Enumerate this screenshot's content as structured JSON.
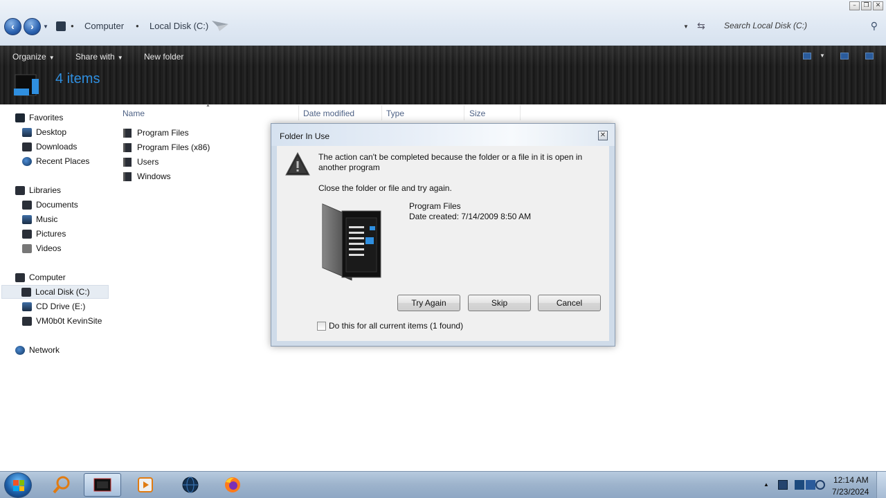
{
  "explorer": {
    "breadcrumb": [
      "Computer",
      "Local Disk (C:)"
    ],
    "search_placeholder": "Search Local Disk (C:)",
    "toolbar": {
      "organize": "Organize",
      "share_with": "Share with",
      "new_folder": "New folder"
    },
    "item_count": "4 items",
    "columns": [
      "Name",
      "Date modified",
      "Type",
      "Size"
    ],
    "files": [
      "Program Files",
      "Program Files (x86)",
      "Users",
      "Windows"
    ]
  },
  "navpane": {
    "favorites": {
      "label": "Favorites",
      "items": [
        "Desktop",
        "Downloads",
        "Recent Places"
      ]
    },
    "libraries": {
      "label": "Libraries",
      "items": [
        "Documents",
        "Music",
        "Pictures",
        "Videos"
      ]
    },
    "computer": {
      "label": "Computer",
      "items": [
        "Local Disk (C:)",
        "CD Drive (E:)",
        "VM0b0t KevinSite"
      ],
      "selected": "Local Disk (C:)"
    },
    "network": {
      "label": "Network"
    }
  },
  "dialog": {
    "title": "Folder In Use",
    "message": "The action can't be completed because the folder or a file in it is open in another program",
    "hint": "Close the folder or file and try again.",
    "file_name": "Program Files",
    "file_date": "Date created: 7/14/2009 8:50 AM",
    "buttons": {
      "try_again": "Try Again",
      "skip": "Skip",
      "cancel": "Cancel"
    },
    "checkbox_label": "Do this for all current items (1 found)",
    "checkbox_checked": false
  },
  "taskbar": {
    "apps": [
      "search-app-icon",
      "explorer-app-icon",
      "media-player-icon",
      "globe-app-icon",
      "firefox-icon"
    ],
    "clock_time": "12:14 AM",
    "clock_date": "7/23/2024"
  },
  "colors": {
    "accent_blue": "#2f8fe0",
    "toolbar_dark": "#1b1b1b",
    "taskbar": "#9db3cc"
  }
}
